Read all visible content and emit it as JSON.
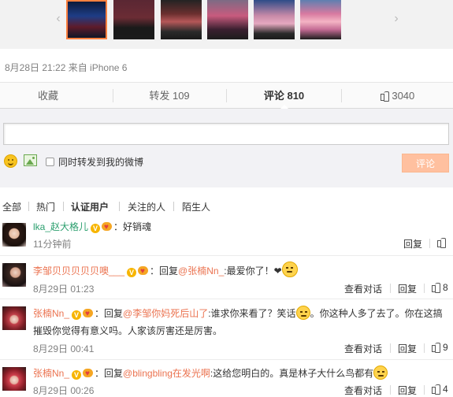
{
  "post_meta": "8月28日 21:22 来自 iPhone 6",
  "actions": {
    "favorite": "收藏",
    "repost_label": "转发",
    "repost_count": "109",
    "comment_label": "评论",
    "comment_count": "810",
    "like_count": "3040"
  },
  "composer": {
    "repost_option": "同时转发到我的微博",
    "submit": "评论"
  },
  "filters": [
    "全部",
    "热门",
    "认证用户",
    "关注的人",
    "陌生人"
  ],
  "comments": [
    {
      "user": "lka_赵大格儿",
      "text": "：好销魂",
      "time": "11分钟前",
      "reply": "回复"
    },
    {
      "user": "李邹贝贝贝贝贝噢___",
      "reply_prefix": "：回复",
      "mention": "@张楠Nn_",
      "text": ":最爱你了！❤",
      "time": "8月29日 01:23",
      "view": "查看对话",
      "reply": "回复",
      "likes": "8"
    },
    {
      "user": "张楠Nn_",
      "reply_prefix": "：回复",
      "mention": "@李邹你妈死后山了",
      "text_line1": ":谁求你来看了？笑话",
      "text_line1b": "。你这种人多了去了。你在这搞",
      "text_line2": "摧毁你觉得有意义吗。人家该厉害还是厉害。",
      "time": "8月29日 00:41",
      "view": "查看对话",
      "reply": "回复",
      "likes": "9"
    },
    {
      "user": "张楠Nn_",
      "reply_prefix": "：回复",
      "mention": "@blingbling在发光啊",
      "text": ":这给您明白的。真是林子大什么鸟都有",
      "time": "8月29日 00:26",
      "view": "查看对话",
      "reply": "回复",
      "likes": "4"
    }
  ]
}
